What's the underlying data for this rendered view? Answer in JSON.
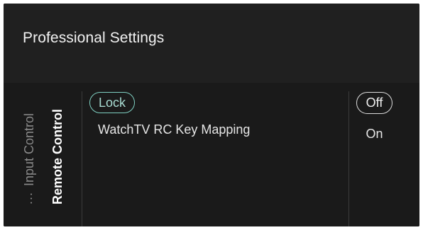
{
  "header": {
    "title": "Professional Settings"
  },
  "nav": {
    "more_indicator": "...",
    "items": [
      {
        "label": "Input Control",
        "state": "inactive"
      },
      {
        "label": "Remote Control",
        "state": "active"
      }
    ]
  },
  "menu": {
    "items": [
      {
        "label": "Lock",
        "state": "highlighted"
      },
      {
        "label": "WatchTV RC Key Mapping"
      }
    ]
  },
  "options": {
    "items": [
      {
        "label": "Off",
        "state": "selected"
      },
      {
        "label": "On"
      }
    ]
  },
  "colors": {
    "background": "#1c1c1c",
    "accent": "#7fd0c2",
    "text": "#e6e6e6"
  }
}
